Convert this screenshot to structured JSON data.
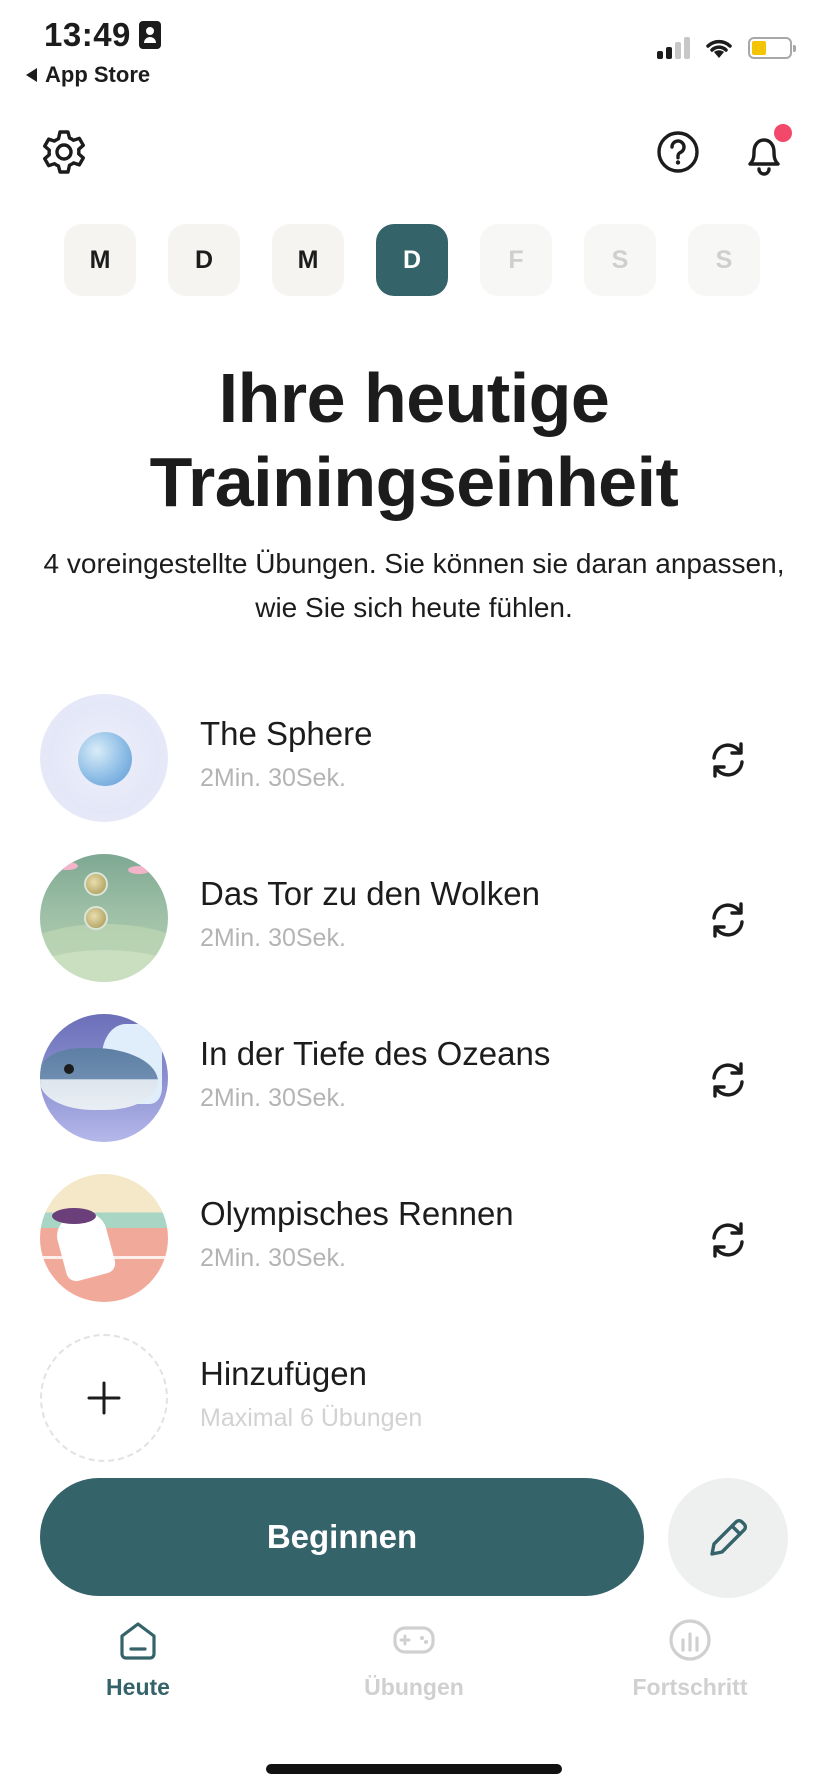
{
  "status_bar": {
    "time": "13:49",
    "back_label": "App Store",
    "battery_color": "#f3c400"
  },
  "header": {
    "settings_icon": "gear-icon",
    "help_icon": "question-circle-icon",
    "bell_icon": "bell-icon",
    "notification_dot_color": "#f2486a"
  },
  "days": [
    {
      "label": "M",
      "state": "past"
    },
    {
      "label": "D",
      "state": "past"
    },
    {
      "label": "M",
      "state": "past"
    },
    {
      "label": "D",
      "state": "active"
    },
    {
      "label": "F",
      "state": "future"
    },
    {
      "label": "S",
      "state": "future"
    },
    {
      "label": "S",
      "state": "future"
    }
  ],
  "main": {
    "title_line1": "Ihre heutige",
    "title_line2": "Trainingseinheit",
    "subtitle": "4 voreingestellte Übungen. Sie können sie daran anpassen, wie Sie sich heute fühlen."
  },
  "exercises": [
    {
      "name": "The Sphere",
      "duration": "2Min. 30Sek."
    },
    {
      "name": "Das Tor zu den Wolken",
      "duration": "2Min. 30Sek."
    },
    {
      "name": "In der Tiefe des Ozeans",
      "duration": "2Min. 30Sek."
    },
    {
      "name": "Olympisches Rennen",
      "duration": "2Min. 30Sek."
    }
  ],
  "add_item": {
    "label": "Hinzufügen",
    "hint": "Maximal 6 Übungen"
  },
  "actions": {
    "begin_label": "Beginnen",
    "edit_icon": "pencil-icon"
  },
  "tabbar": {
    "tabs": [
      {
        "label": "Heute",
        "icon": "home-icon",
        "active": true
      },
      {
        "label": "Übungen",
        "icon": "gamepad-icon",
        "active": false
      },
      {
        "label": "Fortschritt",
        "icon": "chart-icon",
        "active": false
      }
    ]
  },
  "colors": {
    "accent": "#35636a",
    "muted_text": "#b4b4b4"
  }
}
